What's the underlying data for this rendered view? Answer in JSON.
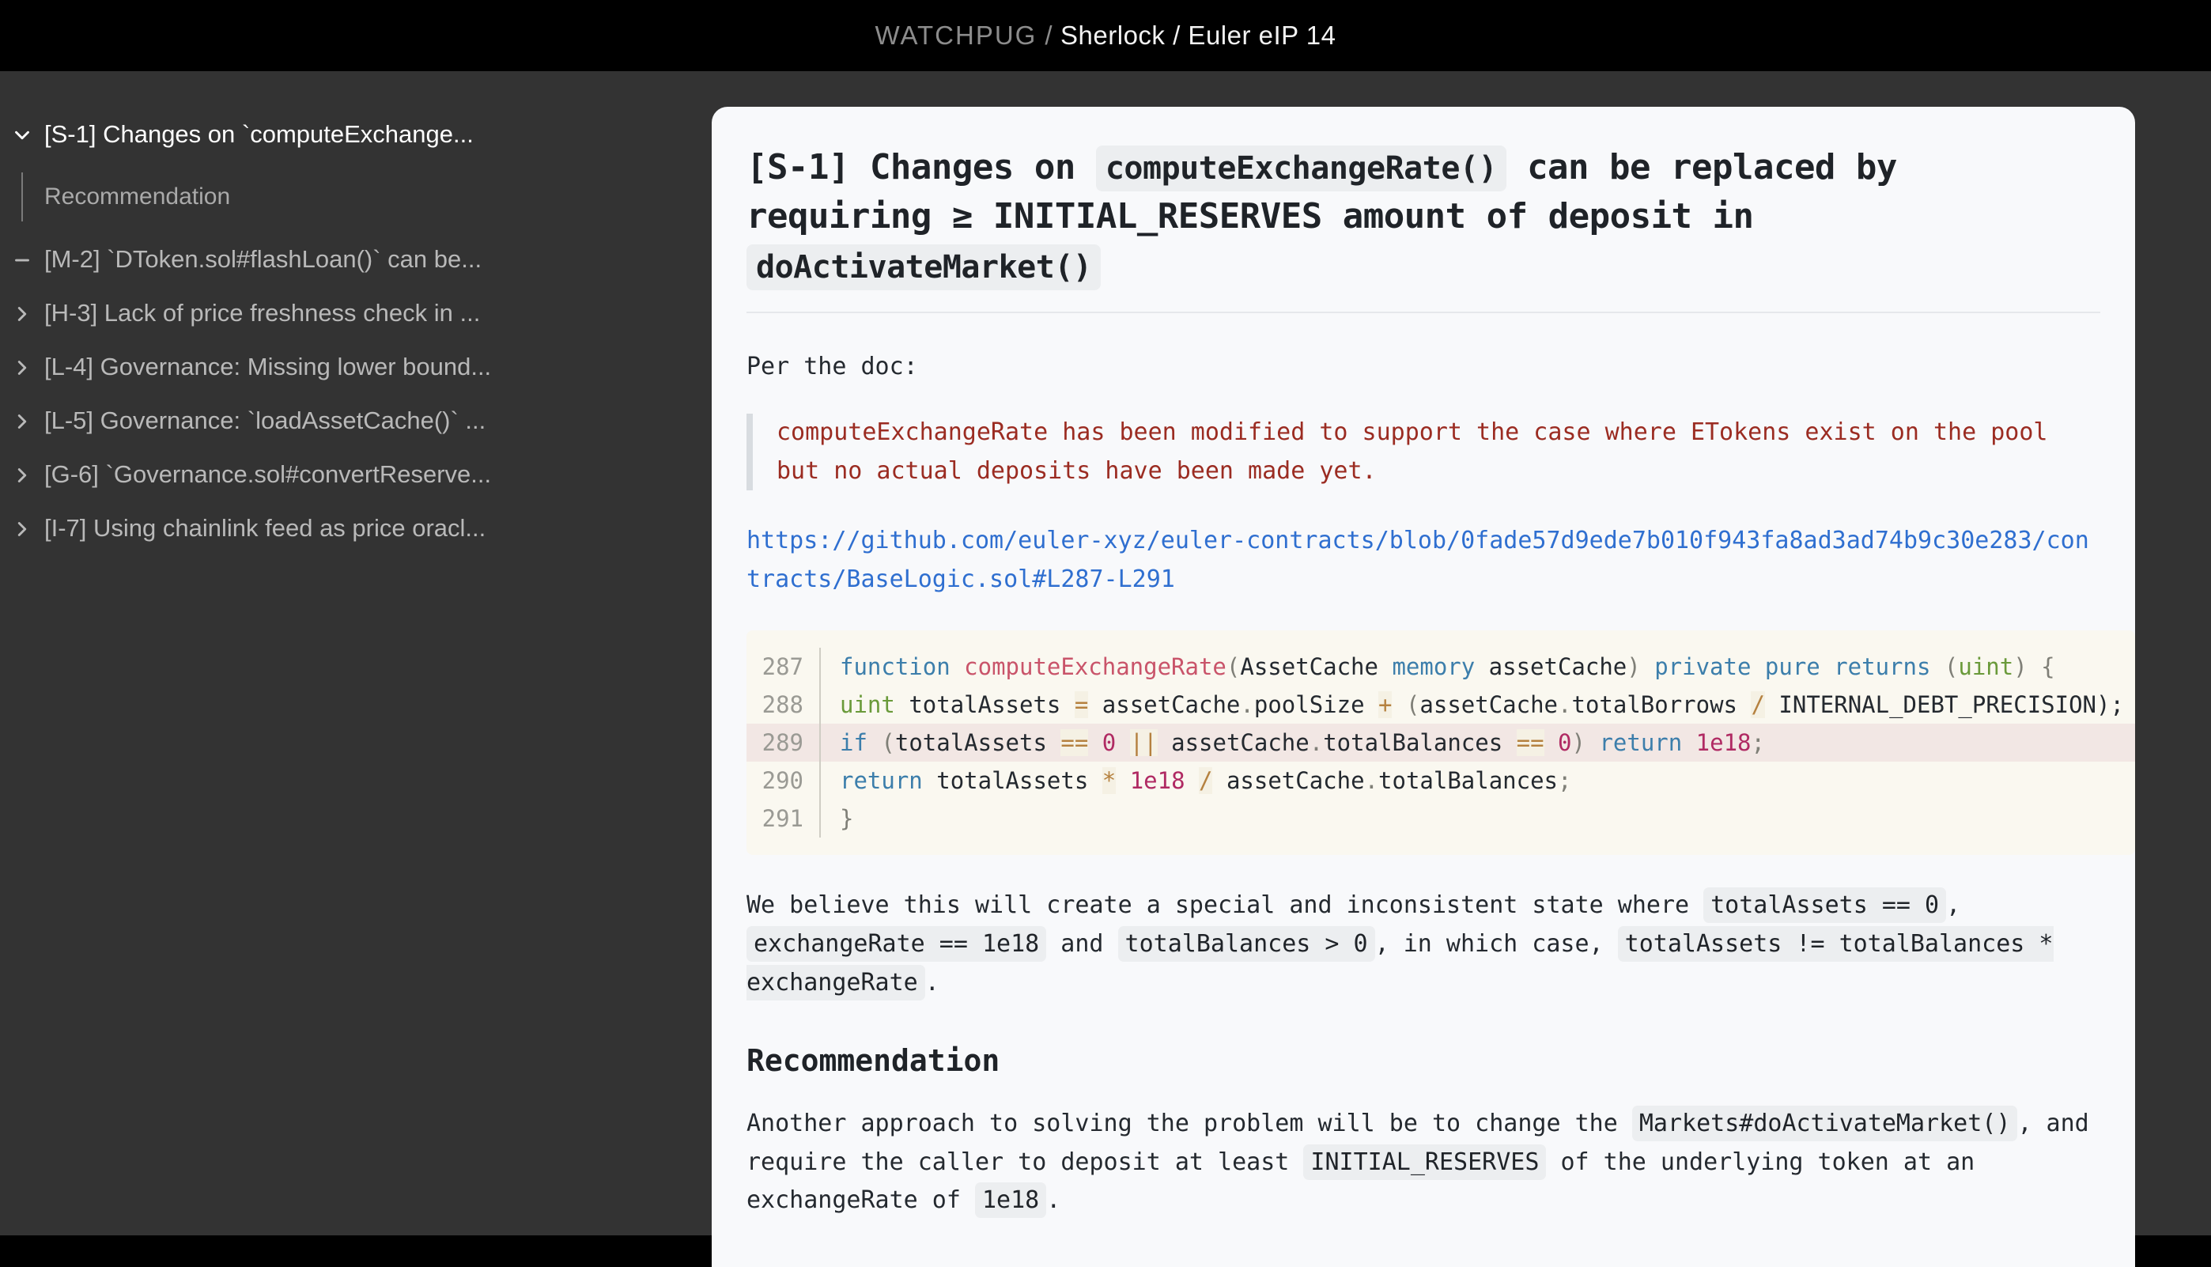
{
  "header": {
    "org": "WATCHPUG",
    "separator": "/",
    "path": "Sherlock / Euler eIP 14"
  },
  "sidebar": {
    "items": [
      {
        "label": "[S-1] Changes on `computeExchange...",
        "icon": "chevron-down-icon",
        "active": true,
        "state": "expanded"
      },
      {
        "label": "[M-2] `DToken.sol#flashLoan()` can be...",
        "icon": "minus-icon",
        "active": false,
        "state": "leaf"
      },
      {
        "label": "[H-3] Lack of price freshness check in ...",
        "icon": "chevron-right-icon",
        "active": false,
        "state": "collapsed"
      },
      {
        "label": "[L-4] Governance: Missing lower bound...",
        "icon": "chevron-right-icon",
        "active": false,
        "state": "collapsed"
      },
      {
        "label": "[L-5] Governance: `loadAssetCache()` ...",
        "icon": "chevron-right-icon",
        "active": false,
        "state": "collapsed"
      },
      {
        "label": "[G-6] `Governance.sol#convertReserve...",
        "icon": "chevron-right-icon",
        "active": false,
        "state": "collapsed"
      },
      {
        "label": "[I-7] Using chainlink feed as price oracl...",
        "icon": "chevron-right-icon",
        "active": false,
        "state": "collapsed"
      }
    ],
    "sub_item": {
      "label": "Recommendation",
      "parent_index": 0
    }
  },
  "main": {
    "title": {
      "part1": "[S-1] Changes on ",
      "code1": "computeExchangeRate()",
      "part2": " can be replaced by requiring ≥ INITIAL_RESERVES amount of deposit in ",
      "code2": "doActivateMarket()"
    },
    "intro": "Per the doc:",
    "quote": "computeExchangeRate has been modified to support the case where ETokens exist on the pool but no actual deposits have been made yet.",
    "link": "https://github.com/euler-xyz/euler-contracts/blob/0fade57d9ede7b010f943fa8ad3ad74b9c30e283/contracts/BaseLogic.sol#L287-L291",
    "code": {
      "lines": [
        {
          "number": "287",
          "highlighted": false,
          "tokens": [
            {
              "t": "function",
              "c": "kw"
            },
            {
              "t": " ",
              "c": "id"
            },
            {
              "t": "computeExchangeRate",
              "c": "fn"
            },
            {
              "t": "(",
              "c": "punc"
            },
            {
              "t": "AssetCache",
              "c": "id"
            },
            {
              "t": " ",
              "c": "id"
            },
            {
              "t": "memory",
              "c": "kw"
            },
            {
              "t": " ",
              "c": "id"
            },
            {
              "t": "assetCache",
              "c": "id"
            },
            {
              "t": ")",
              "c": "punc"
            },
            {
              "t": " ",
              "c": "id"
            },
            {
              "t": "private",
              "c": "kw"
            },
            {
              "t": " ",
              "c": "id"
            },
            {
              "t": "pure",
              "c": "kw"
            },
            {
              "t": " ",
              "c": "id"
            },
            {
              "t": "returns",
              "c": "kw"
            },
            {
              "t": " ",
              "c": "id"
            },
            {
              "t": "(",
              "c": "punc"
            },
            {
              "t": "uint",
              "c": "type"
            },
            {
              "t": ")",
              "c": "punc"
            },
            {
              "t": " ",
              "c": "id"
            },
            {
              "t": "{",
              "c": "punc"
            }
          ]
        },
        {
          "number": "288",
          "highlighted": false,
          "tokens": [
            {
              "t": "    ",
              "c": "id"
            },
            {
              "t": "uint",
              "c": "type"
            },
            {
              "t": " ",
              "c": "id"
            },
            {
              "t": "totalAssets",
              "c": "id"
            },
            {
              "t": " ",
              "c": "id"
            },
            {
              "t": "=",
              "c": "op"
            },
            {
              "t": " ",
              "c": "id"
            },
            {
              "t": "assetCache",
              "c": "id"
            },
            {
              "t": ".",
              "c": "punc"
            },
            {
              "t": "poolSize",
              "c": "prop"
            },
            {
              "t": " ",
              "c": "id"
            },
            {
              "t": "+",
              "c": "op"
            },
            {
              "t": " ",
              "c": "id"
            },
            {
              "t": "(",
              "c": "punc"
            },
            {
              "t": "assetCache",
              "c": "id"
            },
            {
              "t": ".",
              "c": "punc"
            },
            {
              "t": "totalBorrows",
              "c": "prop"
            },
            {
              "t": " ",
              "c": "id"
            },
            {
              "t": "/",
              "c": "op"
            },
            {
              "t": " ",
              "c": "id"
            },
            {
              "t": "INTERNAL_DEBT_PRECISION);",
              "c": "id"
            }
          ]
        },
        {
          "number": "289",
          "highlighted": true,
          "tokens": [
            {
              "t": "    ",
              "c": "id"
            },
            {
              "t": "if",
              "c": "kw"
            },
            {
              "t": " ",
              "c": "id"
            },
            {
              "t": "(",
              "c": "punc"
            },
            {
              "t": "totalAssets",
              "c": "id"
            },
            {
              "t": " ",
              "c": "id"
            },
            {
              "t": "==",
              "c": "op"
            },
            {
              "t": " ",
              "c": "id"
            },
            {
              "t": "0",
              "c": "num"
            },
            {
              "t": " ",
              "c": "id"
            },
            {
              "t": "||",
              "c": "op"
            },
            {
              "t": " ",
              "c": "id"
            },
            {
              "t": "assetCache",
              "c": "id"
            },
            {
              "t": ".",
              "c": "punc"
            },
            {
              "t": "totalBalances",
              "c": "prop"
            },
            {
              "t": " ",
              "c": "id"
            },
            {
              "t": "==",
              "c": "op"
            },
            {
              "t": " ",
              "c": "id"
            },
            {
              "t": "0",
              "c": "num"
            },
            {
              "t": ")",
              "c": "punc"
            },
            {
              "t": " ",
              "c": "id"
            },
            {
              "t": "return",
              "c": "kw"
            },
            {
              "t": " ",
              "c": "id"
            },
            {
              "t": "1e18",
              "c": "num"
            },
            {
              "t": ";",
              "c": "punc"
            }
          ]
        },
        {
          "number": "290",
          "highlighted": false,
          "tokens": [
            {
              "t": "    ",
              "c": "id"
            },
            {
              "t": "return",
              "c": "kw"
            },
            {
              "t": " ",
              "c": "id"
            },
            {
              "t": "totalAssets",
              "c": "id"
            },
            {
              "t": " ",
              "c": "id"
            },
            {
              "t": "*",
              "c": "op"
            },
            {
              "t": " ",
              "c": "id"
            },
            {
              "t": "1e18",
              "c": "num"
            },
            {
              "t": " ",
              "c": "id"
            },
            {
              "t": "/",
              "c": "op"
            },
            {
              "t": " ",
              "c": "id"
            },
            {
              "t": "assetCache",
              "c": "id"
            },
            {
              "t": ".",
              "c": "punc"
            },
            {
              "t": "totalBalances",
              "c": "prop"
            },
            {
              "t": ";",
              "c": "punc"
            }
          ]
        },
        {
          "number": "291",
          "highlighted": false,
          "tokens": [
            {
              "t": "}",
              "c": "punc"
            }
          ]
        }
      ]
    },
    "analysis": {
      "p1": "We believe this will create a special and inconsistent state where ",
      "c1": "totalAssets == 0",
      "p2": ", ",
      "c2": "exchangeRate == 1e18",
      "p3": " and ",
      "c3": "totalBalances > 0",
      "p4": ", in which case, ",
      "c4": "totalAssets != totalBalances * exchangeRate",
      "p5": "."
    },
    "recommendation": {
      "heading": "Recommendation",
      "p1": "Another approach to solving the problem will be to change the ",
      "c1": "Markets#doActivateMarket()",
      "p2": ", and require the caller to deposit at least ",
      "c2": "INITIAL_RESERVES",
      "p3": " of the underlying token at an exchangeRate of ",
      "c3": "1e18",
      "p4": "."
    }
  }
}
